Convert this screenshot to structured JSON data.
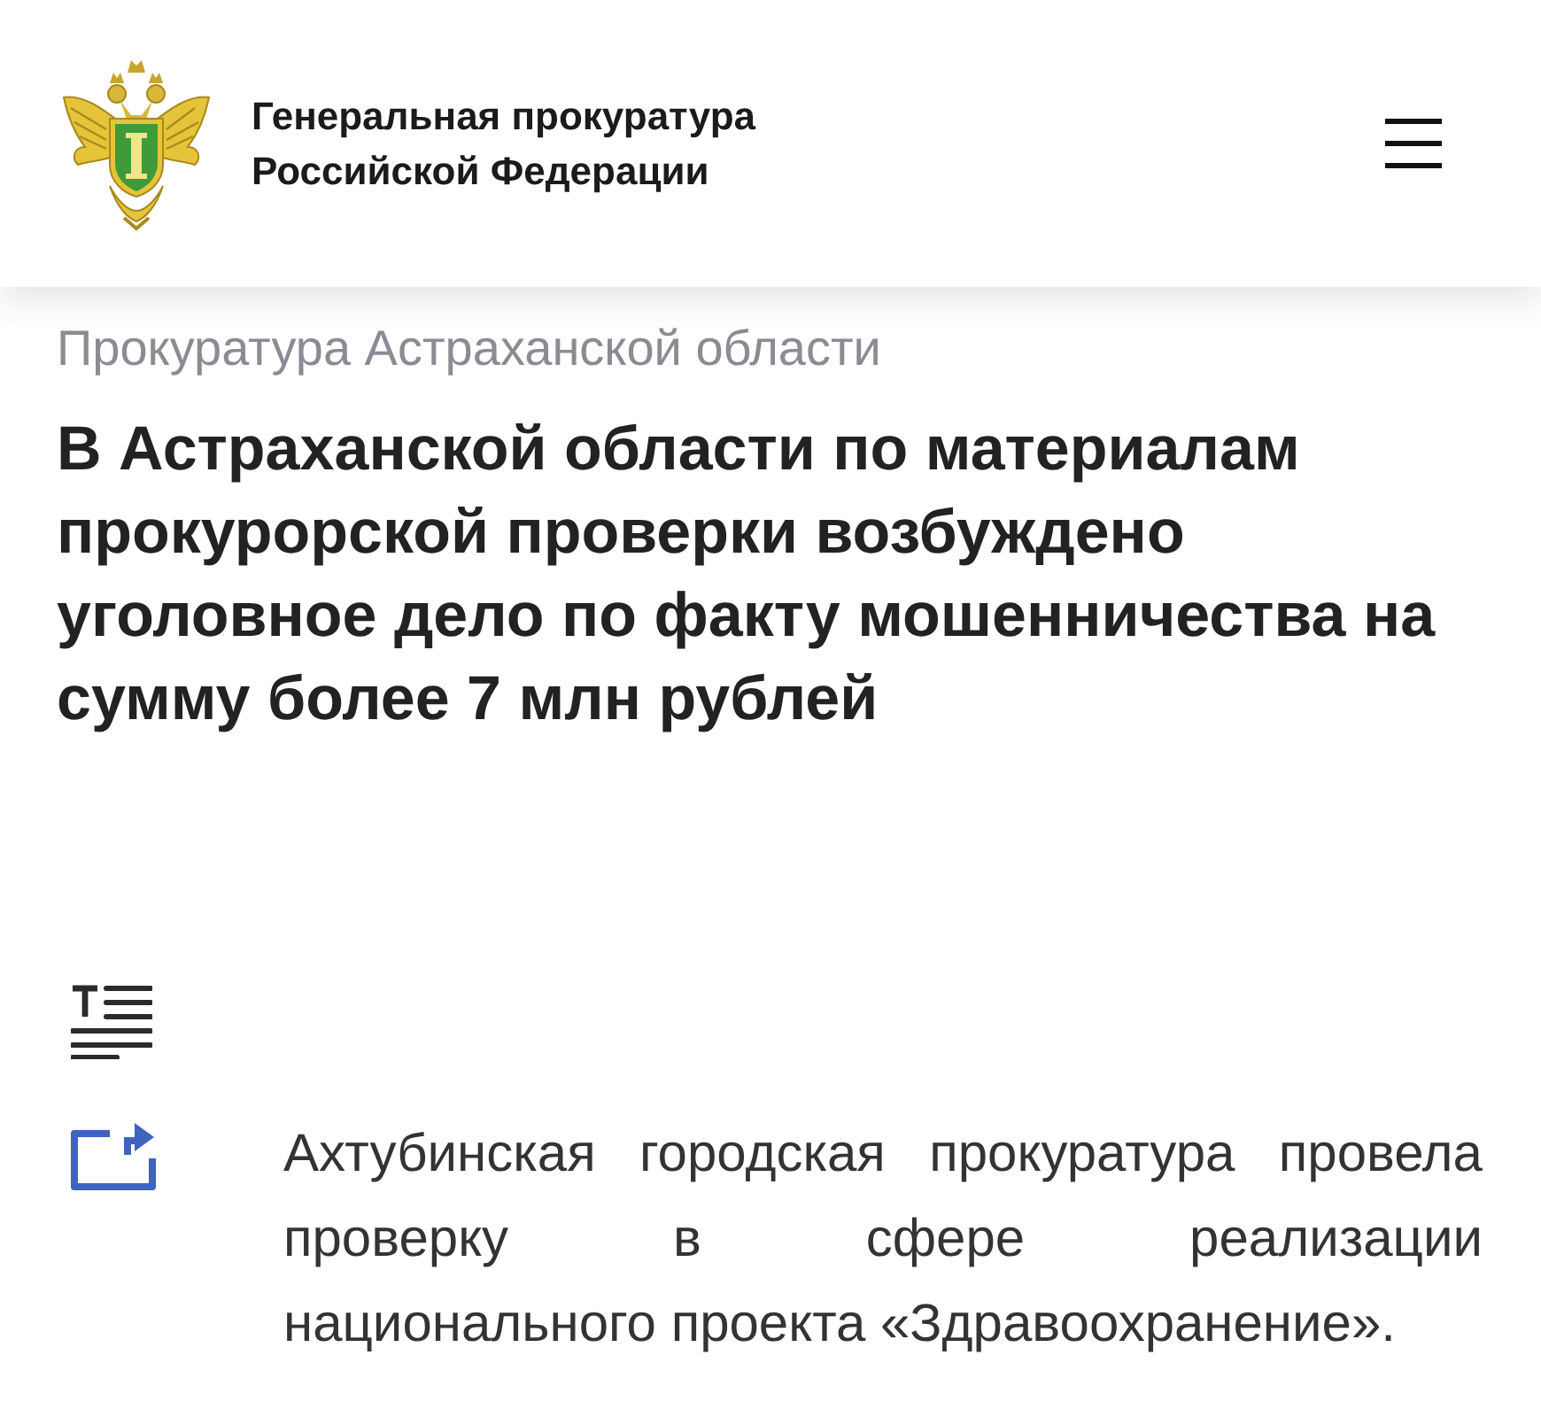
{
  "header": {
    "title": "Генеральная прокуратура Российской Федерации"
  },
  "breadcrumb": "Прокуратура Астраханской области",
  "headline": "В Астраханской области по материалам прокурорской проверки возбуждено уголовное дело по факту мошенничества на сумму более 7 млн рублей",
  "article": {
    "text": "Ахтубинская городская прокуратура провела проверку в сфере реализации национального проекта «Здравоохранение»."
  }
}
